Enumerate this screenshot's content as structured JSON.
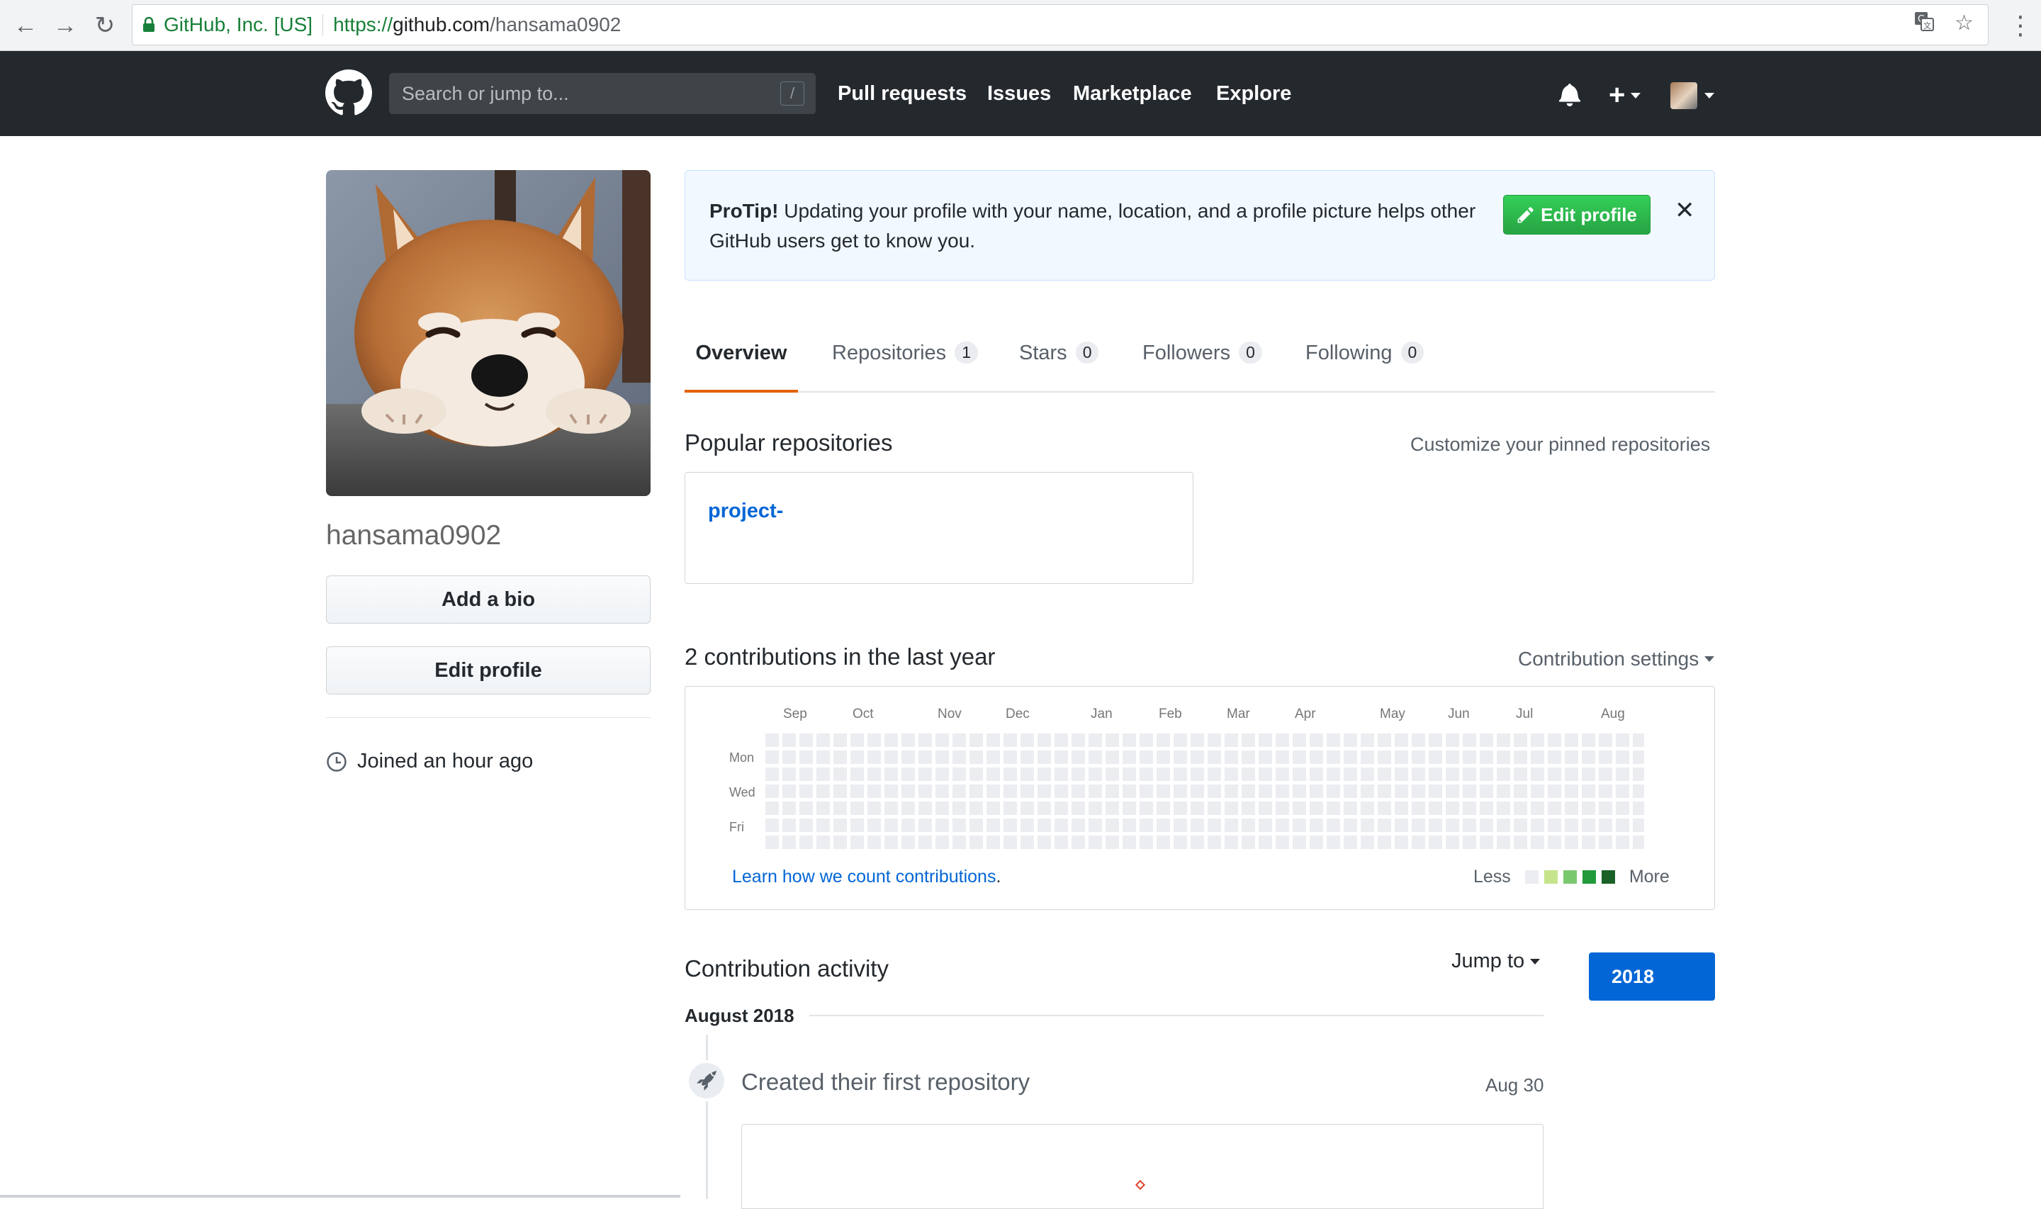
{
  "browser": {
    "secure_label": "GitHub, Inc. [US]",
    "url_proto": "https://",
    "url_host": "github.com",
    "url_path": "/hansama0902",
    "icons": [
      "back-icon",
      "forward-icon",
      "reload-icon",
      "lock-icon",
      "translate-icon",
      "star-icon",
      "kebab-menu-icon"
    ]
  },
  "header": {
    "search_placeholder": "Search or jump to...",
    "search_shortcut": "/",
    "nav": [
      "Pull requests",
      "Issues",
      "Marketplace",
      "Explore"
    ],
    "plus": "+",
    "icons": [
      "github-logo-icon",
      "bell-icon",
      "plus-icon",
      "avatar"
    ]
  },
  "profile": {
    "username": "hansama0902",
    "add_bio": "Add a bio",
    "edit_profile": "Edit profile",
    "joined": "Joined an hour ago"
  },
  "protip": {
    "bold": "ProTip!",
    "text": " Updating your profile with your name, location, and a profile picture helps other GitHub users get to know you.",
    "button": "Edit profile",
    "close": "✕"
  },
  "tabs": [
    {
      "label": "Overview",
      "count": null
    },
    {
      "label": "Repositories",
      "count": "1"
    },
    {
      "label": "Stars",
      "count": "0"
    },
    {
      "label": "Followers",
      "count": "0"
    },
    {
      "label": "Following",
      "count": "0"
    }
  ],
  "popular": {
    "title": "Popular repositories",
    "customize": "Customize your pinned repositories",
    "repo_name": "project-"
  },
  "contributions": {
    "title": "2 contributions in the last year",
    "settings": "Contribution settings",
    "months": [
      "Sep",
      "Oct",
      "Nov",
      "Dec",
      "Jan",
      "Feb",
      "Mar",
      "Apr",
      "May",
      "Jun",
      "Jul",
      "Aug"
    ],
    "days": [
      "Mon",
      "Wed",
      "Fri"
    ],
    "learn_link": "Learn how we count contributions",
    "learn_period": ".",
    "less": "Less",
    "more": "More",
    "colors": [
      "#ebedf0",
      "#c6e48b",
      "#7bc96f",
      "#239a3b",
      "#196127"
    ]
  },
  "activity": {
    "title": "Contribution activity",
    "jump_to": "Jump to",
    "year": "2018",
    "month": "August 2018",
    "event": "Created their first repository",
    "date": "Aug 30"
  }
}
